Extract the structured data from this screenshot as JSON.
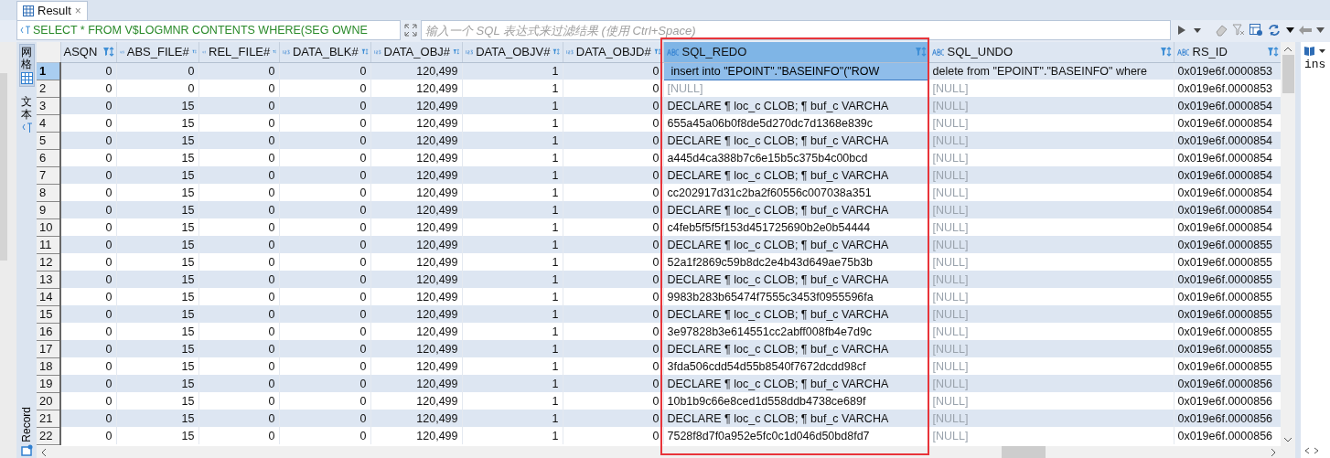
{
  "tab": {
    "title": "Result",
    "close": "×"
  },
  "filter": {
    "query": "SELECT * FROM V$LOGMNR CONTENTS WHERE(SEG OWNE",
    "placeholder": "输入一个 SQL 表达式来过滤结果 (使用 Ctrl+Space)"
  },
  "view_tabs": [
    {
      "label": "网格",
      "kind": "grid",
      "selected": true
    },
    {
      "label": "文本",
      "kind": "text",
      "selected": false
    },
    {
      "label": "Record",
      "kind": "record",
      "selected": false
    }
  ],
  "columns": [
    {
      "label": "ASQN",
      "kind": "cut",
      "selected": false
    },
    {
      "label": "ABS_FILE#",
      "kind": "number",
      "selected": false
    },
    {
      "label": "REL_FILE#",
      "kind": "number",
      "selected": false
    },
    {
      "label": "DATA_BLK#",
      "kind": "number",
      "selected": false
    },
    {
      "label": "DATA_OBJ#",
      "kind": "number",
      "selected": false
    },
    {
      "label": "DATA_OBJV#",
      "kind": "number",
      "selected": false
    },
    {
      "label": "DATA_OBJD#",
      "kind": "number",
      "selected": false
    },
    {
      "label": "SQL_REDO",
      "kind": "text",
      "selected": true
    },
    {
      "label": "SQL_UNDO",
      "kind": "text",
      "selected": false
    },
    {
      "label": "RS_ID",
      "kind": "text",
      "selected": false
    }
  ],
  "rows": [
    {
      "number": "1",
      "selected": true,
      "cells": [
        "0",
        "0",
        "0",
        "0",
        "120,499",
        "1",
        "0",
        "insert into \"EPOINT\".\"BASEINFO\"(\"ROW",
        "delete from \"EPOINT\".\"BASEINFO\" where",
        "0x019e6f.0000853"
      ]
    },
    {
      "number": "2",
      "selected": false,
      "cells": [
        "0",
        "0",
        "0",
        "0",
        "120,499",
        "1",
        "0",
        {
          "text": "[NULL]",
          "null": true
        },
        {
          "text": "[NULL]",
          "null": true
        },
        "0x019e6f.0000853"
      ]
    },
    {
      "number": "3",
      "selected": false,
      "cells": [
        "0",
        "15",
        "0",
        "0",
        "120,499",
        "1",
        "0",
        "DECLARE ¶ loc_c CLOB; ¶ buf_c VARCHA",
        {
          "text": "[NULL]",
          "null": true
        },
        "0x019e6f.0000854"
      ]
    },
    {
      "number": "4",
      "selected": false,
      "cells": [
        "0",
        "15",
        "0",
        "0",
        "120,499",
        "1",
        "0",
        "655a45a06b0f8de5d270dc7d1368e839c",
        {
          "text": "[NULL]",
          "null": true
        },
        "0x019e6f.0000854"
      ]
    },
    {
      "number": "5",
      "selected": false,
      "cells": [
        "0",
        "15",
        "0",
        "0",
        "120,499",
        "1",
        "0",
        "DECLARE ¶ loc_c CLOB; ¶ buf_c VARCHA",
        {
          "text": "[NULL]",
          "null": true
        },
        "0x019e6f.0000854"
      ]
    },
    {
      "number": "6",
      "selected": false,
      "cells": [
        "0",
        "15",
        "0",
        "0",
        "120,499",
        "1",
        "0",
        "a445d4ca388b7c6e15b5c375b4c00bcd",
        {
          "text": "[NULL]",
          "null": true
        },
        "0x019e6f.0000854"
      ]
    },
    {
      "number": "7",
      "selected": false,
      "cells": [
        "0",
        "15",
        "0",
        "0",
        "120,499",
        "1",
        "0",
        "DECLARE ¶ loc_c CLOB; ¶ buf_c VARCHA",
        {
          "text": "[NULL]",
          "null": true
        },
        "0x019e6f.0000854"
      ]
    },
    {
      "number": "8",
      "selected": false,
      "cells": [
        "0",
        "15",
        "0",
        "0",
        "120,499",
        "1",
        "0",
        "cc202917d31c2ba2f60556c007038a351",
        {
          "text": "[NULL]",
          "null": true
        },
        "0x019e6f.0000854"
      ]
    },
    {
      "number": "9",
      "selected": false,
      "cells": [
        "0",
        "15",
        "0",
        "0",
        "120,499",
        "1",
        "0",
        "DECLARE ¶ loc_c CLOB; ¶ buf_c VARCHA",
        {
          "text": "[NULL]",
          "null": true
        },
        "0x019e6f.0000854"
      ]
    },
    {
      "number": "10",
      "selected": false,
      "cells": [
        "0",
        "15",
        "0",
        "0",
        "120,499",
        "1",
        "0",
        "c4feb5f5f5f153d451725690b2e0b54444",
        {
          "text": "[NULL]",
          "null": true
        },
        "0x019e6f.0000854"
      ]
    },
    {
      "number": "11",
      "selected": false,
      "cells": [
        "0",
        "15",
        "0",
        "0",
        "120,499",
        "1",
        "0",
        "DECLARE ¶ loc_c CLOB; ¶ buf_c VARCHA",
        {
          "text": "[NULL]",
          "null": true
        },
        "0x019e6f.0000855"
      ]
    },
    {
      "number": "12",
      "selected": false,
      "cells": [
        "0",
        "15",
        "0",
        "0",
        "120,499",
        "1",
        "0",
        "52a1f2869c59b8dc2e4b43d649ae75b3b",
        {
          "text": "[NULL]",
          "null": true
        },
        "0x019e6f.0000855"
      ]
    },
    {
      "number": "13",
      "selected": false,
      "cells": [
        "0",
        "15",
        "0",
        "0",
        "120,499",
        "1",
        "0",
        "DECLARE ¶ loc_c CLOB; ¶ buf_c VARCHA",
        {
          "text": "[NULL]",
          "null": true
        },
        "0x019e6f.0000855"
      ]
    },
    {
      "number": "14",
      "selected": false,
      "cells": [
        "0",
        "15",
        "0",
        "0",
        "120,499",
        "1",
        "0",
        "9983b283b65474f7555c3453f0955596fa",
        {
          "text": "[NULL]",
          "null": true
        },
        "0x019e6f.0000855"
      ]
    },
    {
      "number": "15",
      "selected": false,
      "cells": [
        "0",
        "15",
        "0",
        "0",
        "120,499",
        "1",
        "0",
        "DECLARE ¶ loc_c CLOB; ¶ buf_c VARCHA",
        {
          "text": "[NULL]",
          "null": true
        },
        "0x019e6f.0000855"
      ]
    },
    {
      "number": "16",
      "selected": false,
      "cells": [
        "0",
        "15",
        "0",
        "0",
        "120,499",
        "1",
        "0",
        "3e97828b3e614551cc2abff008fb4e7d9c",
        {
          "text": "[NULL]",
          "null": true
        },
        "0x019e6f.0000855"
      ]
    },
    {
      "number": "17",
      "selected": false,
      "cells": [
        "0",
        "15",
        "0",
        "0",
        "120,499",
        "1",
        "0",
        "DECLARE ¶ loc_c CLOB; ¶ buf_c VARCHA",
        {
          "text": "[NULL]",
          "null": true
        },
        "0x019e6f.0000855"
      ]
    },
    {
      "number": "18",
      "selected": false,
      "cells": [
        "0",
        "15",
        "0",
        "0",
        "120,499",
        "1",
        "0",
        "3fda506cdd54d55b8540f7672dcdd98cf",
        {
          "text": "[NULL]",
          "null": true
        },
        "0x019e6f.0000855"
      ]
    },
    {
      "number": "19",
      "selected": false,
      "cells": [
        "0",
        "15",
        "0",
        "0",
        "120,499",
        "1",
        "0",
        "DECLARE ¶ loc_c CLOB; ¶ buf_c VARCHA",
        {
          "text": "[NULL]",
          "null": true
        },
        "0x019e6f.0000856"
      ]
    },
    {
      "number": "20",
      "selected": false,
      "cells": [
        "0",
        "15",
        "0",
        "0",
        "120,499",
        "1",
        "0",
        "10b1b9c66e8ced1d558ddb4738ce689f",
        {
          "text": "[NULL]",
          "null": true
        },
        "0x019e6f.0000856"
      ]
    },
    {
      "number": "21",
      "selected": false,
      "cells": [
        "0",
        "15",
        "0",
        "0",
        "120,499",
        "1",
        "0",
        "DECLARE ¶ loc_c CLOB; ¶ buf_c VARCHA",
        {
          "text": "[NULL]",
          "null": true
        },
        "0x019e6f.0000856"
      ]
    },
    {
      "number": "22",
      "selected": false,
      "cells": [
        "0",
        "15",
        "0",
        "0",
        "120,499",
        "1",
        "0",
        "7528f8d7f0a952e5fc0c1d046d50bd8fd7",
        {
          "text": "[NULL]",
          "null": true
        },
        "0x019e6f.0000856"
      ]
    }
  ],
  "side_panel": {
    "text": "ins"
  }
}
